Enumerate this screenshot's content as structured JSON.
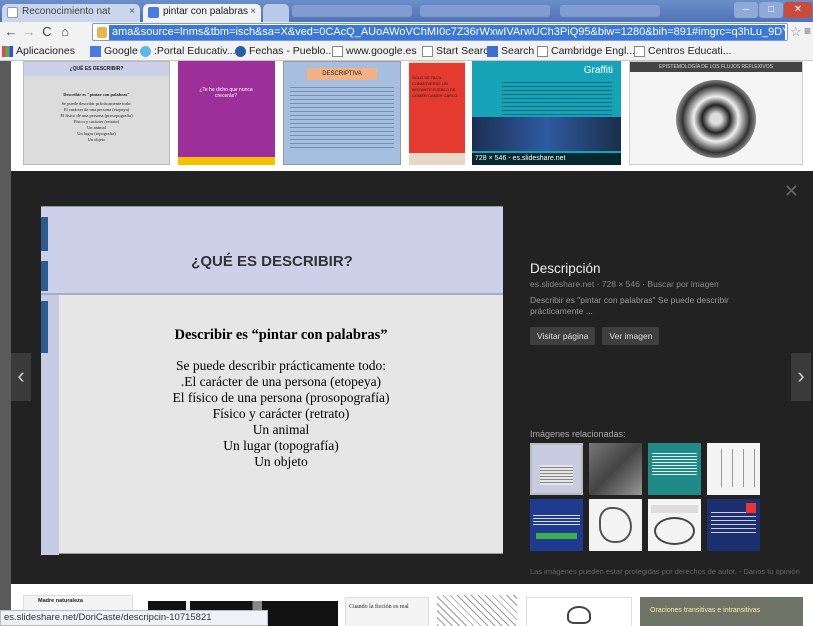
{
  "browser": {
    "tabs": [
      {
        "label": "Reconocimiento nat",
        "active": false
      },
      {
        "label": "pintar con palabras",
        "active": true
      }
    ],
    "url": "ama&source=lnms&tbm=isch&sa=X&ved=0CAcQ_AUoAWoVChMI0c7Z36rWxwIVArwUCh3PiQ95&biw=1280&bih=891#imgrc=q3hLu_9DYu18bM%3A",
    "bookmarks": [
      {
        "label": "Aplicaciones",
        "icon": "apps-icon"
      },
      {
        "label": "Google",
        "icon": "google-icon"
      },
      {
        "label": ":Portal Educativ...",
        "icon": "portal-icon"
      },
      {
        "label": "Fechas - Pueblo...",
        "icon": "wikipedia-icon"
      },
      {
        "label": "www.google.es",
        "icon": "page-icon"
      },
      {
        "label": "Start Search",
        "icon": "page-icon"
      },
      {
        "label": "Search",
        "icon": "search-bm-icon"
      },
      {
        "label": "Cambridge Engl...",
        "icon": "page-icon"
      },
      {
        "label": "Centros Educati...",
        "icon": "page-icon"
      }
    ]
  },
  "results_strip": {
    "thumbs": [
      {
        "title": "¿QUÉ ES DESCRIBIR?",
        "lines": [
          "Describir es \"pintar con palabras\"",
          "Se puede describir prácticamente todo:",
          "El carácter de una persona (etopeya)",
          "El físico de una persona (prosopografía)",
          "Físico y carácter (retrato)",
          "Un animal",
          "Un lugar (topografía)",
          "Un objeto"
        ]
      },
      {
        "text": "¿Te he dicho que nunca crecerás?"
      },
      {
        "title": "DESCRIPTIVA"
      },
      {
        "text": "SOLO SE FACIL CONMOVERSE UN INSTANTE PUEBLO DE COMER CAMER CARLO"
      },
      {
        "title": "Graffiti",
        "caption": "728 × 546 - es.slideshare.net"
      },
      {
        "title": "EPISTEMOLOGÍA DE LOS FLUJOS REFLEXIVOS"
      }
    ]
  },
  "viewer": {
    "slide": {
      "title": "¿QUÉ ES DESCRIBIR?",
      "heading": "Describir es “pintar con palabras”",
      "lines": [
        "Se puede describir prácticamente todo:",
        ".El carácter de una persona (etopeya)",
        "El físico de una persona (prosopografía)",
        "Físico y carácter (retrato)",
        "Un animal",
        "Un lugar (topografía)",
        "Un objeto"
      ]
    },
    "info": {
      "title": "Descripción",
      "meta": "es.slideshare.net · 728 × 546 · Buscar por imagen",
      "description": "Describir es \"pintar con palabras\" Se puede describir prácticamente ...",
      "visit_label": "Visitar página",
      "view_label": "Ver imagen",
      "related_label": "Imágenes relacionadas:",
      "disclaimer": "Las imágenes pueden estar protegidas por derechos de autor. - Danos tu opinión"
    }
  },
  "bottom_strip": {
    "thumbs": [
      {
        "text": "Madre naturaleza"
      },
      {
        "text": ""
      },
      {
        "text": "Cuando la ficción es real"
      },
      {
        "text": ""
      },
      {
        "text": ""
      },
      {
        "text": "Oraciones transitivas e intransitivas"
      }
    ]
  },
  "status_url": "es.slideshare.net/DoriCaste/descripcin-10715821",
  "colors": {
    "chrome_frame": "#5b7fc3",
    "overlay_bg": "#222222",
    "slide_header": "#ccd0e8",
    "slide_accent": "#2d5a91"
  }
}
